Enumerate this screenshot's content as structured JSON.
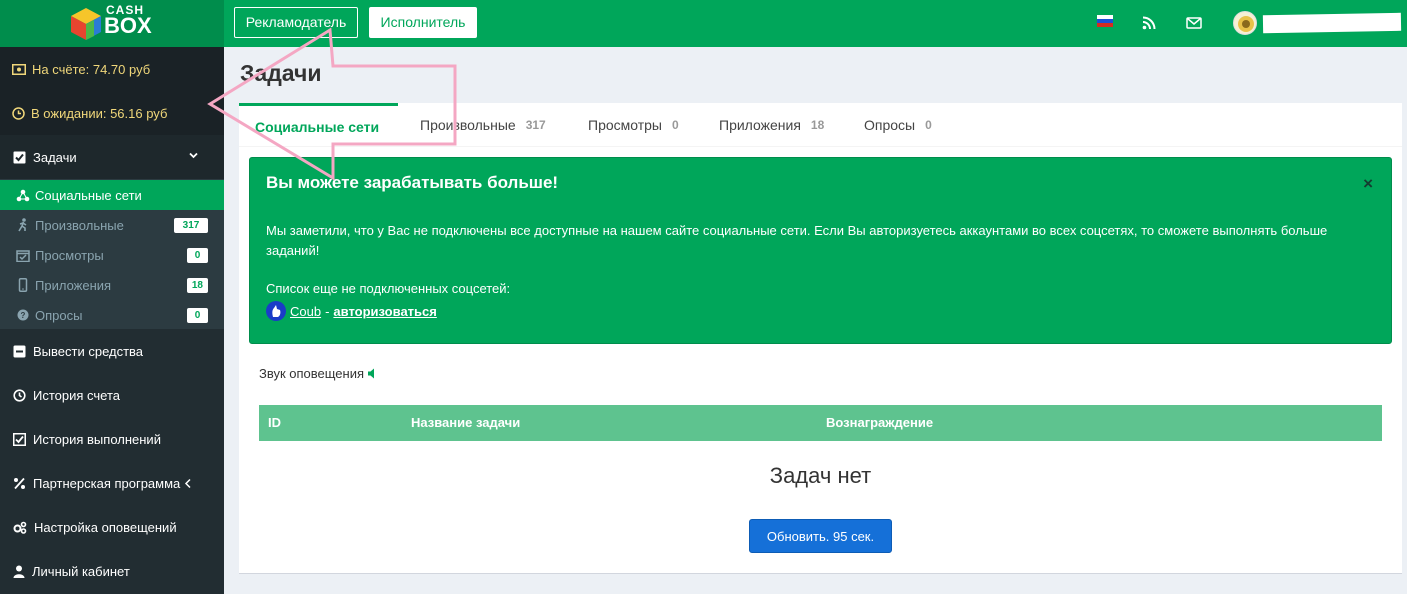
{
  "header": {
    "logo_top": "CASH",
    "logo_bottom": "BOX",
    "advertiser_label": "Рекламодатель",
    "executor_label": "Исполнитель"
  },
  "sidebar": {
    "balance": "На счёте: 74.70 руб",
    "pending": "В ожидании: 56.16 руб",
    "tasks_label": "Задачи",
    "submenu": [
      {
        "label": "Социальные сети",
        "count": ""
      },
      {
        "label": "Произвольные",
        "count": "317"
      },
      {
        "label": "Просмотры",
        "count": "0"
      },
      {
        "label": "Приложения",
        "count": "18"
      },
      {
        "label": "Опросы",
        "count": "0"
      }
    ],
    "items": [
      {
        "label": "Вывести средства"
      },
      {
        "label": "История счета"
      },
      {
        "label": "История выполнений"
      },
      {
        "label": "Партнерская программа"
      },
      {
        "label": "Настройка оповещений"
      },
      {
        "label": "Личный кабинет"
      }
    ]
  },
  "main": {
    "title": "Задачи",
    "tabs": [
      {
        "label": "Социальные сети",
        "count": ""
      },
      {
        "label": "Произвольные",
        "count": "317"
      },
      {
        "label": "Просмотры",
        "count": "0"
      },
      {
        "label": "Приложения",
        "count": "18"
      },
      {
        "label": "Опросы",
        "count": "0"
      }
    ],
    "alert": {
      "title": "Вы можете зарабатывать больше!",
      "close": "×",
      "text": "Мы заметили, что у Вас не подключены все доступные на нашем сайте социальные сети. Если Вы авторизуетесь аккаунтами во всех соцсетях, то сможете выполнять больше заданий!",
      "list_title": "Список еще не подключенных соцсетей:",
      "network": "Coub",
      "separator": "-",
      "auth_link": "авторизоваться"
    },
    "sound_label": "Звук оповещения",
    "table": {
      "columns": [
        "ID",
        "Название задачи",
        "Вознаграждение"
      ]
    },
    "empty_text": "Задач нет",
    "refresh_label": "Обновить. 95 сек."
  },
  "colors": {
    "brand_green": "#00a65a",
    "sidebar_bg": "#222d32",
    "balance_text": "#f0d77a",
    "refresh_blue": "#1570d8",
    "annotation_pink": "#f4a7c3"
  }
}
